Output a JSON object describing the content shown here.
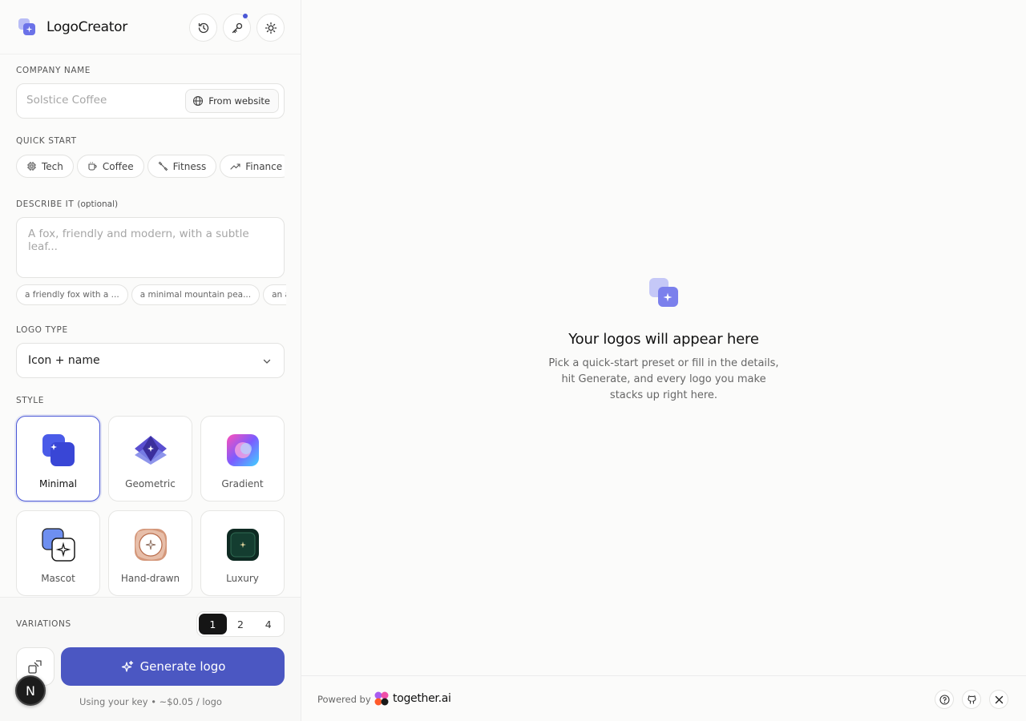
{
  "app": {
    "name": "LogoCreator"
  },
  "header": {
    "icons": [
      "history-icon",
      "key-icon",
      "sun-icon"
    ]
  },
  "company": {
    "label": "COMPANY NAME",
    "placeholder": "Solstice Coffee",
    "from_website": "From website"
  },
  "quick_start": {
    "label": "QUICK START",
    "presets": [
      {
        "label": "Tech",
        "icon": "chip-icon"
      },
      {
        "label": "Coffee",
        "icon": "cup-icon"
      },
      {
        "label": "Fitness",
        "icon": "dumbbell-icon"
      },
      {
        "label": "Finance",
        "icon": "trend-icon"
      }
    ]
  },
  "describe": {
    "label": "DESCRIBE IT",
    "optional": "(optional)",
    "placeholder": "A fox, friendly and modern, with a subtle leaf...",
    "suggestions": [
      "a friendly fox with a ...",
      "a minimal mountain pea...",
      "an abs"
    ]
  },
  "logo_type": {
    "label": "LOGO TYPE",
    "value": "Icon + name"
  },
  "style": {
    "label": "STYLE",
    "options": [
      "Minimal",
      "Geometric",
      "Gradient",
      "Mascot",
      "Hand-drawn",
      "Luxury"
    ],
    "selected": "Minimal"
  },
  "variations": {
    "label": "VARIATIONS",
    "options": [
      "1",
      "2",
      "4"
    ],
    "selected": "1"
  },
  "generate": {
    "label": "Generate logo",
    "note": "Using your key • ~$0.05 / logo"
  },
  "avatar": {
    "initial": "N"
  },
  "empty_state": {
    "title": "Your logos will appear here",
    "text": "Pick a quick-start preset or fill in the details, hit Generate, and every logo you make stacks up right here."
  },
  "footer": {
    "powered_by": "Powered by",
    "brand": "together.ai",
    "icons": [
      "help-icon",
      "github-icon",
      "x-icon"
    ]
  },
  "colors": {
    "accent": "#4a57d6",
    "button": "#4b57c2",
    "background": "#fbfbfa"
  }
}
